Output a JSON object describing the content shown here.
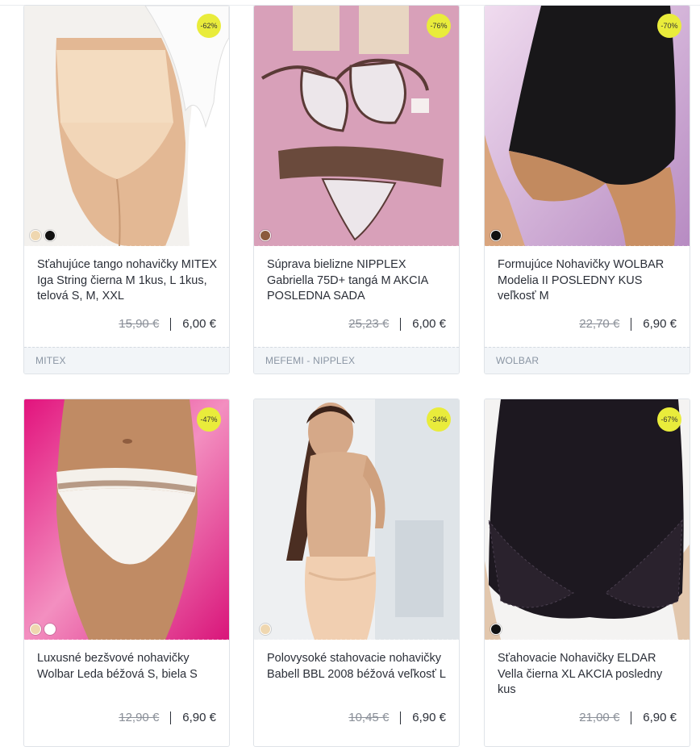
{
  "products": [
    {
      "title": "Sťahujúce tango nohavičky MITEX Iga String čierna M 1kus, L 1kus,  telová S, M,  XXL",
      "old_price": "15,90 €",
      "price": "6,00 €",
      "discount": "-62%",
      "brand": "MITEX",
      "swatches": [
        "#efd7b0",
        "#111111"
      ]
    },
    {
      "title": "Súprava bielizne NIPPLEX Gabriella 75D+ tangá M AKCIA POSLEDNA SADA",
      "old_price": "25,23 €",
      "price": "6,00 €",
      "discount": "-76%",
      "brand": "MEFEMI - NIPPLEX",
      "swatches": [
        "#8b5a3c"
      ]
    },
    {
      "title": "Formujúce Nohavičky WOLBAR Modelia II POSLEDNY KUS veľkosť M",
      "old_price": "22,70 €",
      "price": "6,90 €",
      "discount": "-70%",
      "brand": "WOLBAR",
      "swatches": [
        "#111111"
      ]
    },
    {
      "title": "Luxusné bezšvové nohavičky Wolbar Leda béžová S, biela S",
      "old_price": "12,90 €",
      "price": "6,90 €",
      "discount": "-47%",
      "brand": "",
      "swatches": [
        "#efd7b0",
        "#ffffff"
      ]
    },
    {
      "title": "Polovysoké stahovacie nohavičky Babell BBL 2008 béžová veľkosť L",
      "old_price": "10,45 €",
      "price": "6,90 €",
      "discount": "-34%",
      "brand": "",
      "swatches": [
        "#efd7b0"
      ]
    },
    {
      "title": "Sťahovacie Nohavičky ELDAR Vella čierna XL AKCIA posledny kus",
      "old_price": "21,00 €",
      "price": "6,90 €",
      "discount": "-67%",
      "brand": "",
      "swatches": [
        "#111111"
      ]
    }
  ],
  "colors": {
    "badge": "#e9ec3b",
    "brandbar": "#f2f5f8",
    "text": "#2b2f38"
  }
}
